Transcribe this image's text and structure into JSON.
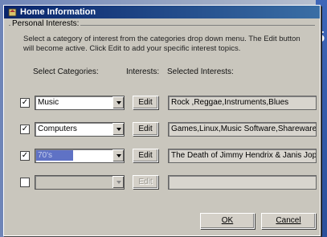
{
  "window": {
    "title": "Home Information"
  },
  "group": {
    "label": "Personal Interests:"
  },
  "description": "Select a category of interest from the categories drop down menu. The Edit button will become active. Click Edit to add your specific interest topics.",
  "headers": {
    "categories": "Select Categories:",
    "interests": "Interests:",
    "selected": "Selected Interests:"
  },
  "rows": [
    {
      "checked": true,
      "category": "Music",
      "edit": "Edit",
      "interests": "Rock ,Reggae,Instruments,Blues"
    },
    {
      "checked": true,
      "category": "Computers",
      "edit": "Edit",
      "interests": "Games,Linux,Music Software,Shareware"
    },
    {
      "checked": true,
      "category": "70's",
      "edit": "Edit",
      "interests": "The Death of Jimmy Hendrix & Janis Jopli"
    },
    {
      "checked": false,
      "category": "",
      "edit": "Edit",
      "interests": ""
    }
  ],
  "buttons": {
    "ok": "OK",
    "cancel": "Cancel"
  },
  "icons": {
    "title": "home-icon",
    "checkmark": "✓"
  }
}
